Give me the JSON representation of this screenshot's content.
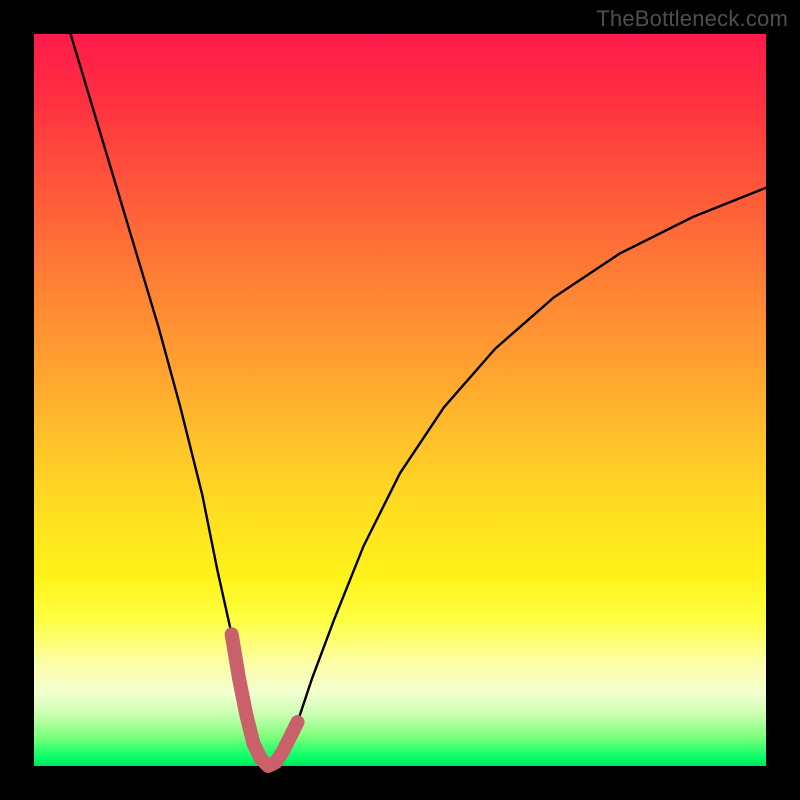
{
  "watermark": "TheBottleneck.com",
  "chart_data": {
    "type": "line",
    "title": "",
    "xlabel": "",
    "ylabel": "",
    "xlim": [
      0,
      100
    ],
    "ylim": [
      0,
      100
    ],
    "grid": false,
    "legend": false,
    "series": [
      {
        "name": "bottleneck-curve",
        "color": "#000000",
        "x": [
          5,
          8,
          11,
          14,
          17,
          20,
          23,
          25,
          27,
          28,
          29,
          30,
          31,
          32,
          33,
          34,
          36,
          38,
          41,
          45,
          50,
          56,
          63,
          71,
          80,
          90,
          100
        ],
        "y": [
          100,
          90,
          80,
          70,
          60,
          49,
          37,
          27,
          18,
          12,
          7,
          3,
          1,
          0,
          0.5,
          2,
          6,
          12,
          20,
          30,
          40,
          49,
          57,
          64,
          70,
          75,
          79
        ]
      },
      {
        "name": "bottleneck-curve-highlight",
        "color": "#c9606a",
        "x": [
          27,
          28,
          29,
          30,
          31,
          32,
          33,
          34,
          36
        ],
        "y": [
          18,
          12,
          7,
          3,
          1,
          0,
          0.5,
          2,
          6
        ]
      }
    ],
    "gradient_bands": [
      {
        "pct": 0,
        "color": "#ff1a4b"
      },
      {
        "pct": 10,
        "color": "#ff3340"
      },
      {
        "pct": 22,
        "color": "#ff5a3a"
      },
      {
        "pct": 33,
        "color": "#ff7d35"
      },
      {
        "pct": 45,
        "color": "#ffa030"
      },
      {
        "pct": 56,
        "color": "#ffc32a"
      },
      {
        "pct": 66,
        "color": "#ffe020"
      },
      {
        "pct": 74,
        "color": "#fff21a"
      },
      {
        "pct": 80,
        "color": "#feff40"
      },
      {
        "pct": 86,
        "color": "#fdffa8"
      },
      {
        "pct": 90,
        "color": "#f2ffd0"
      },
      {
        "pct": 93,
        "color": "#c8ffb0"
      },
      {
        "pct": 96,
        "color": "#7dff7d"
      },
      {
        "pct": 99,
        "color": "#00ff66"
      },
      {
        "pct": 100,
        "color": "#00e060"
      }
    ]
  }
}
